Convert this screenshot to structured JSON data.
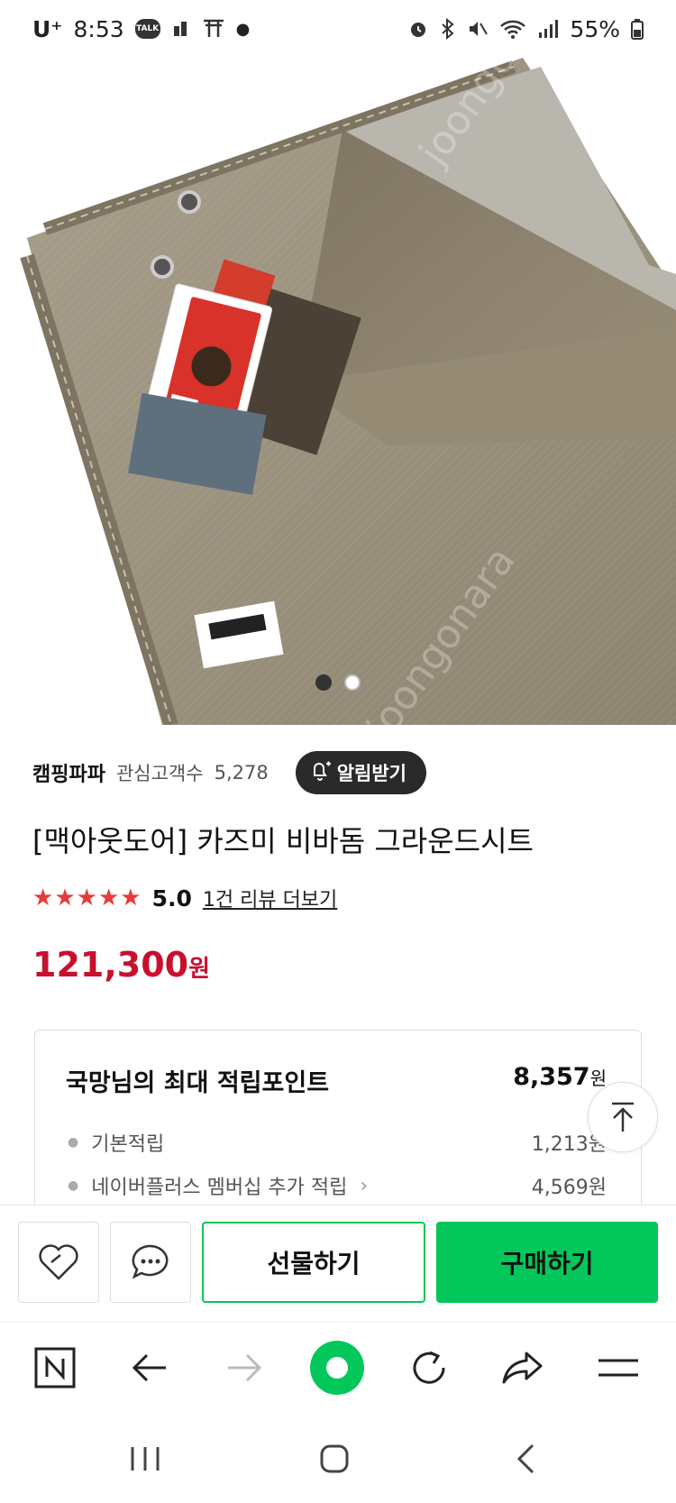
{
  "status_bar": {
    "carrier": "U⁺",
    "time": "8:53",
    "talk_badge": "TALK",
    "battery": "55%"
  },
  "product": {
    "watermark_1": "joongonara.com",
    "watermark_2": "joongonara",
    "store_name": "캠핑파파",
    "follower_label": "관심고객수",
    "follower_count": "5,278",
    "alarm_label": "알림받기",
    "title": "[맥아웃도어] 카즈미 비바돔 그라운드시트",
    "rating": "5.0",
    "rating_stars": 5,
    "review_link": "1건 리뷰 더보기",
    "price": "121,300",
    "price_unit": "원"
  },
  "points": {
    "title": "국망님의 최대 적립포인트",
    "total": "8,357",
    "unit": "원",
    "items": [
      {
        "label": "기본적립",
        "value": "1,213원"
      },
      {
        "label": "네이버플러스 멤버십 추가 적립",
        "value": "4,569원"
      }
    ]
  },
  "actions": {
    "gift_label": "선물하기",
    "buy_label": "구매하기"
  },
  "colors": {
    "accent_green": "#03c75a",
    "price_red": "#c8102e",
    "star_red": "#e73a3a"
  }
}
